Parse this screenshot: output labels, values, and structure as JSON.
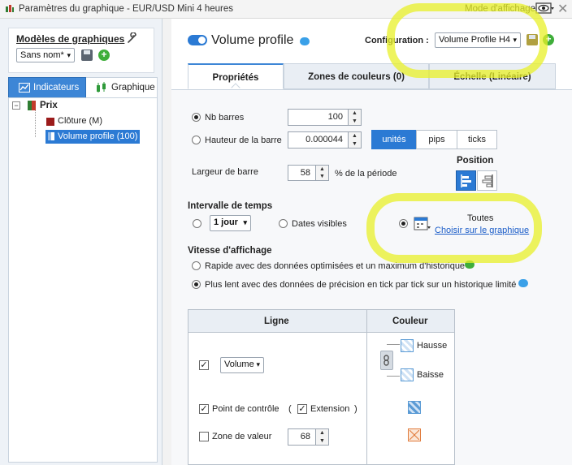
{
  "window": {
    "title": "Paramètres du graphique - EUR/USD Mini 4 heures",
    "mode_label": "Mode d'affichage"
  },
  "left": {
    "templates_title": "Modèles de graphiques",
    "template_value": "Sans nom*",
    "tabs": [
      "Indicateurs",
      "Graphique"
    ],
    "tree": {
      "root": "Prix",
      "children": [
        "Clôture (M)",
        "Volume profile (100)"
      ]
    }
  },
  "header": {
    "title": "Volume profile",
    "config_label": "Configuration :",
    "config_value": "Volume Profile H4"
  },
  "tabs": [
    "Propriétés",
    "Zones de couleurs (0)",
    "Échelle (Linéaire)"
  ],
  "props": {
    "nb_bars_label": "Nb barres",
    "nb_bars_value": "100",
    "bar_height_label": "Hauteur de la barre",
    "bar_height_value": "0.000044",
    "units": [
      "unités",
      "pips",
      "ticks"
    ],
    "position_label": "Position",
    "bar_width_label": "Largeur de barre",
    "bar_width_value": "58",
    "bar_width_suffix": "% de la période",
    "time_interval_title": "Intervalle de temps",
    "interval_value": "1 jour",
    "visible_dates_label": "Dates visibles",
    "all_label": "Toutes",
    "choose_link": "Choisir sur le graphique",
    "speed_title": "Vitesse d'affichage",
    "speed_fast": "Rapide avec des données optimisées et un maximum d'historique",
    "speed_slow": "Plus lent avec des données de précision en tick par tick sur un historique limité"
  },
  "table": {
    "col_line": "Ligne",
    "col_color": "Couleur",
    "volume_select": "Volume",
    "hausse": "Hausse",
    "baisse": "Baisse",
    "control_point": "Point de contrôle",
    "extension_open": "(",
    "extension": "Extension",
    "extension_close": ")",
    "value_zone": "Zone de valeur",
    "value_zone_value": "68"
  },
  "colors": {
    "accent": "#2b7ad4",
    "highlight": "#e8f028",
    "swatch_blue": "#5b9bd5",
    "swatch_orange": "#e07a3a"
  }
}
